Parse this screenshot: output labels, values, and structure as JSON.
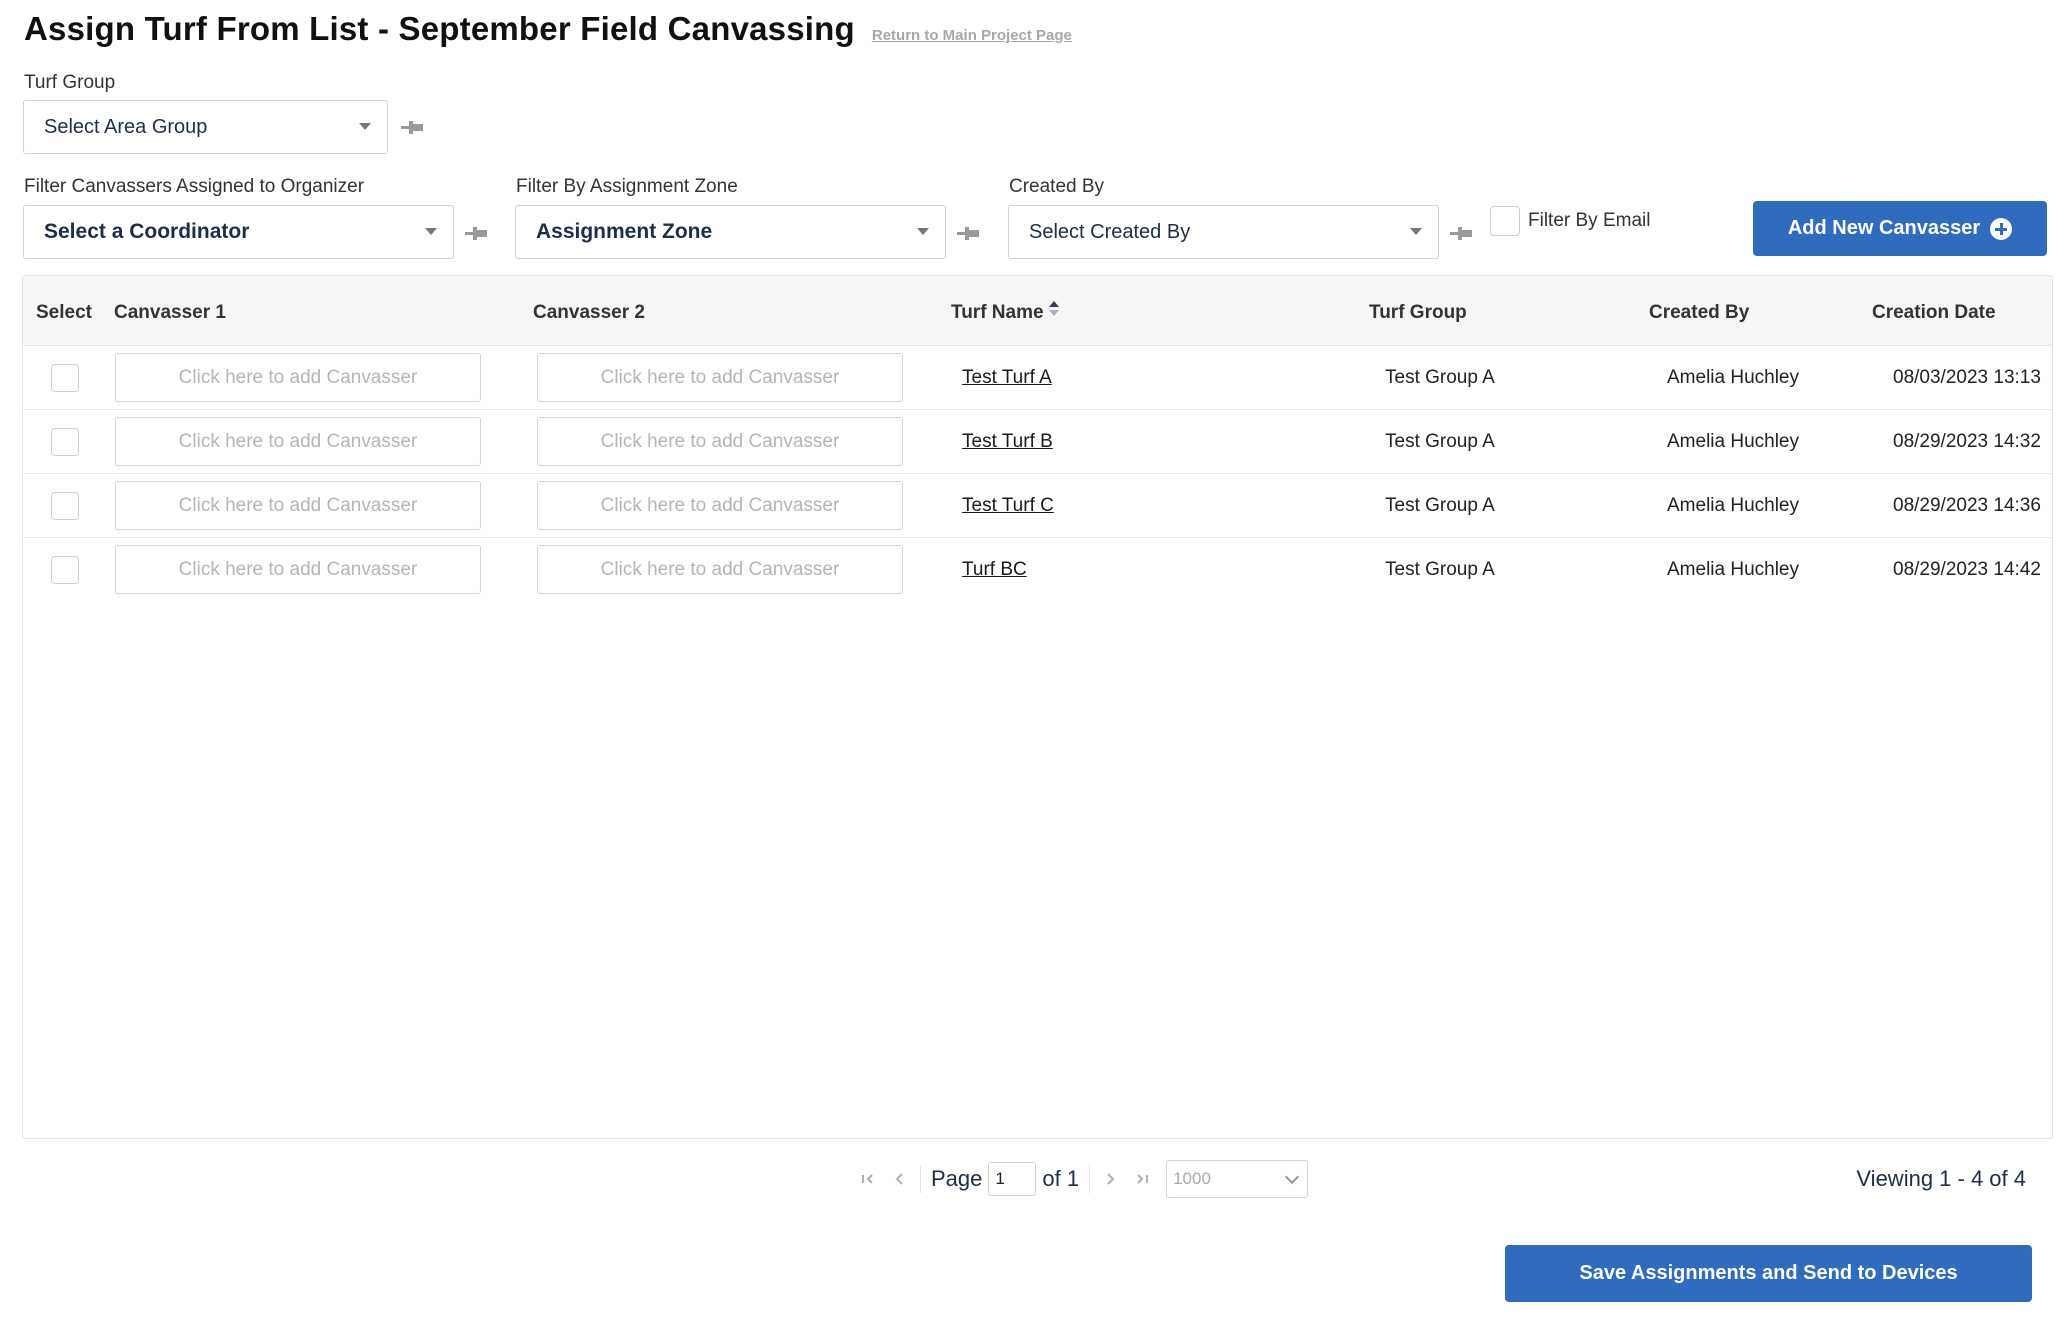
{
  "header": {
    "title": "Assign Turf From List - September Field Canvassing",
    "return_link": "Return to Main Project Page"
  },
  "filters": {
    "turf_group_label": "Turf Group",
    "turf_group_value": "Select Area Group",
    "organizer_label": "Filter Canvassers Assigned to Organizer",
    "organizer_value": "Select a Coordinator",
    "zone_label": "Filter By Assignment Zone",
    "zone_value": "Assignment Zone",
    "created_by_label": "Created By",
    "created_by_value": "Select Created By",
    "email_label": "Filter By Email"
  },
  "add_button": "Add New Canvasser",
  "table": {
    "columns": [
      "Select",
      "Canvasser 1",
      "Canvasser 2",
      "Turf Name",
      "Turf Group",
      "Created By",
      "Creation Date"
    ],
    "placeholder": "Click here to add Canvasser",
    "rows": [
      {
        "turf": "Test Turf A",
        "group": "Test Group A",
        "created_by": "Amelia Huchley",
        "date": "08/03/2023 13:13"
      },
      {
        "turf": "Test Turf B",
        "group": "Test Group A",
        "created_by": "Amelia Huchley",
        "date": "08/29/2023 14:32"
      },
      {
        "turf": "Test Turf C",
        "group": "Test Group A",
        "created_by": "Amelia Huchley",
        "date": "08/29/2023 14:36"
      },
      {
        "turf": "Turf BC",
        "group": "Test Group A",
        "created_by": "Amelia Huchley",
        "date": "08/29/2023 14:42"
      }
    ]
  },
  "pager": {
    "page_label": "Page",
    "page_value": "1",
    "of_label": "of 1",
    "page_size": "1000",
    "viewing": "Viewing 1 - 4 of 4"
  },
  "save_button": "Save Assignments and Send to Devices",
  "colors": {
    "primary": "#2f6bbf",
    "text_dark": "#1f2d4a"
  }
}
